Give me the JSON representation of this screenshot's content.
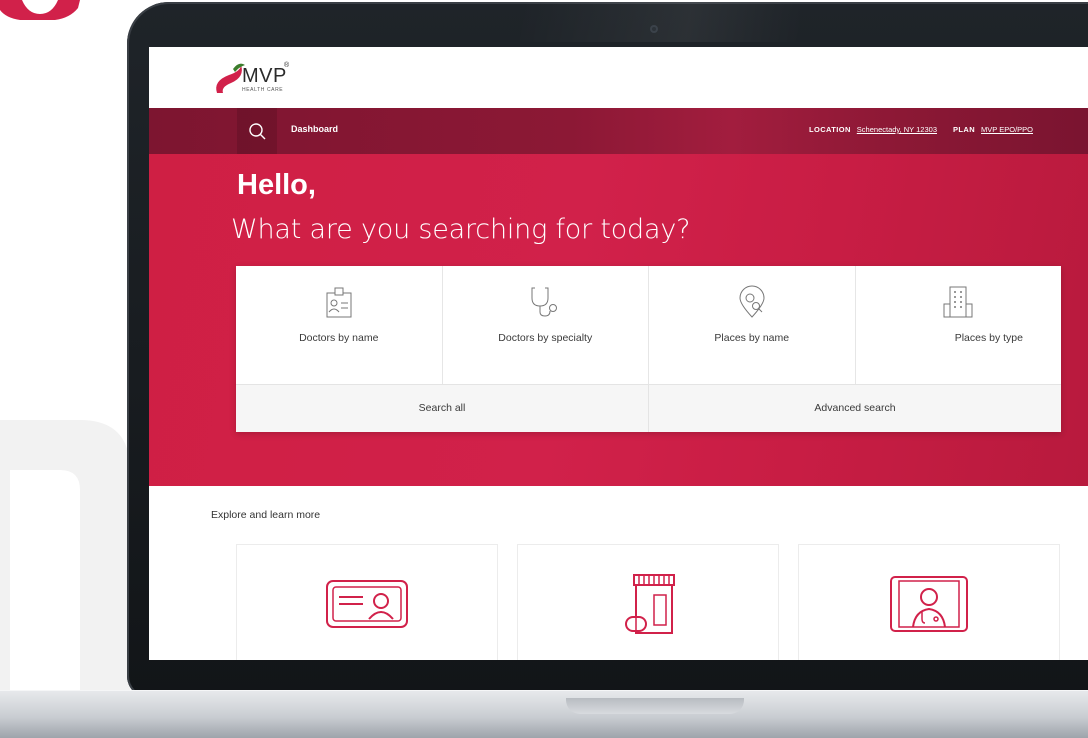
{
  "colors": {
    "brand_red": "#d1214a",
    "nav_maroon": "#8c1835",
    "panel_bg": "#ffffff",
    "action_bg": "#f6f6f6",
    "text_dark": "#3a3a3a"
  },
  "header": {
    "logo_name": "MVP",
    "logo_registered": "®",
    "logo_subtitle": "HEALTH CARE",
    "logo_icon": "mvp-swoosh-icon"
  },
  "nav": {
    "search_icon": "search-icon",
    "dashboard": "Dashboard",
    "location_label": "LOCATION",
    "location_value": "Schenectady, NY 12303",
    "plan_label": "PLAN",
    "plan_value": "MVP EPO/PPO"
  },
  "hero": {
    "greeting": "Hello,",
    "question": "What are you searching for today?"
  },
  "search_tiles": [
    {
      "label": "Doctors by name",
      "icon": "id-badge-icon"
    },
    {
      "label": "Doctors by specialty",
      "icon": "stethoscope-icon"
    },
    {
      "label": "Places by name",
      "icon": "location-search-icon"
    },
    {
      "label": "Places by type",
      "icon": "building-icon"
    }
  ],
  "search_actions": [
    {
      "label": "Search all"
    },
    {
      "label": "Advanced search"
    }
  ],
  "explore": {
    "title": "Explore and learn more",
    "cards": [
      {
        "icon": "member-id-card-icon"
      },
      {
        "icon": "prescription-bottle-icon"
      },
      {
        "icon": "telehealth-doctor-icon"
      }
    ]
  }
}
